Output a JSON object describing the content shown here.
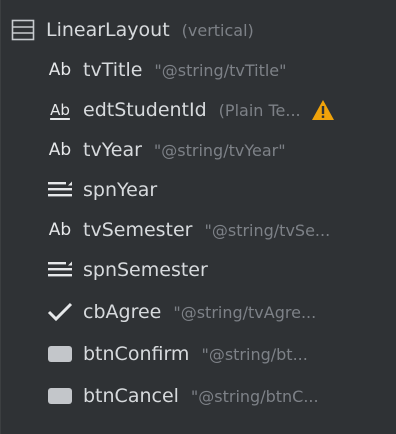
{
  "component_tree": {
    "root": {
      "name": "LinearLayout",
      "detail": "(vertical)",
      "icon": "linear-layout-icon"
    },
    "children": [
      {
        "icon": "textview-icon",
        "name": "tvTitle",
        "detail": "\"@string/tvTitle\""
      },
      {
        "icon": "edittext-icon",
        "name": "edtStudentId",
        "detail": "(Plain Te...",
        "warning": true
      },
      {
        "icon": "textview-icon",
        "name": "tvYear",
        "detail": "\"@string/tvYear\""
      },
      {
        "icon": "spinner-icon",
        "name": "spnYear",
        "detail": ""
      },
      {
        "icon": "textview-icon",
        "name": "tvSemester",
        "detail": "\"@string/tvSe..."
      },
      {
        "icon": "spinner-icon",
        "name": "spnSemester",
        "detail": ""
      },
      {
        "icon": "checkbox-icon",
        "name": "cbAgree",
        "detail": "\"@string/tvAgre..."
      },
      {
        "icon": "button-icon",
        "name": "btnConfirm",
        "detail": "\"@string/bt..."
      },
      {
        "icon": "button-icon",
        "name": "btnCancel",
        "detail": "\"@string/btnC..."
      }
    ],
    "icon_glyph_text": "Ab",
    "colors": {
      "background": "#2f3235",
      "name_text": "#d7dadd",
      "detail_text": "#7d8187",
      "warning": "#f0a30a"
    }
  }
}
